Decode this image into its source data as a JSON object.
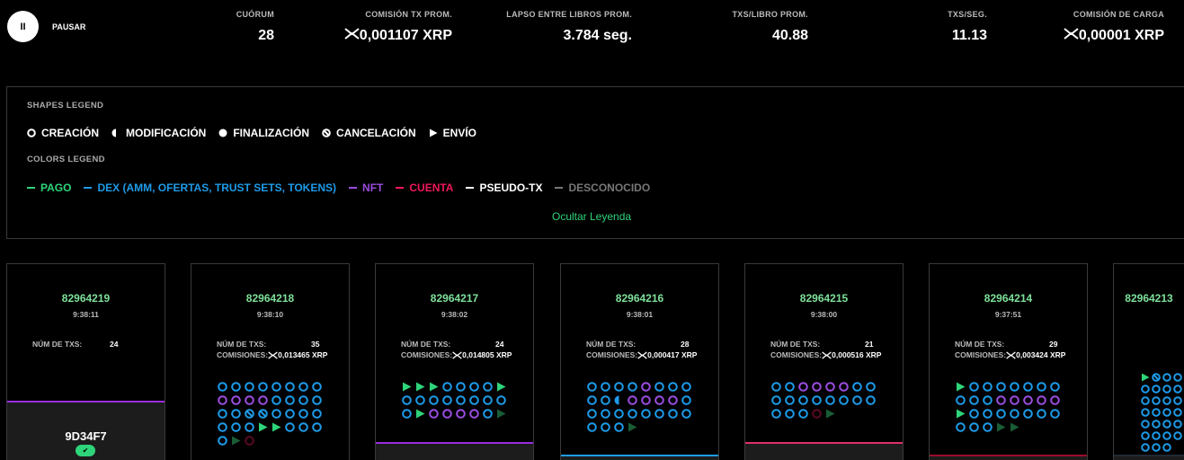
{
  "header": {
    "pause_label": "PAUSAR",
    "pause_icon": "II",
    "stats": [
      {
        "label": "CUÓRUM",
        "value": "28",
        "xrp": false
      },
      {
        "label": "COMISIÓN TX PROM.",
        "value": "0,001107 XRP",
        "xrp": true
      },
      {
        "label": "LAPSO ENTRE LIBROS PROM.",
        "value": "3.784 seg.",
        "xrp": false
      },
      {
        "label": "TXS/LIBRO PROM.",
        "value": "40.88",
        "xrp": false
      },
      {
        "label": "TXS/SEG.",
        "value": "11.13",
        "xrp": false
      },
      {
        "label": "COMISIÓN DE CARGA",
        "value": "0,00001 XRP",
        "xrp": true
      }
    ]
  },
  "legend": {
    "shapes_title": "SHAPES LEGEND",
    "shapes": [
      {
        "shape": "o",
        "label": "CREACIÓN"
      },
      {
        "shape": "h",
        "label": "MODIFICACIÓN"
      },
      {
        "shape": "f",
        "label": "FINALIZACIÓN"
      },
      {
        "shape": "x",
        "label": "CANCELACIÓN"
      },
      {
        "shape": "t",
        "label": "ENVÍO"
      }
    ],
    "colors_title": "COLORS LEGEND",
    "colors": [
      {
        "label": "PAGO",
        "color": "#2ed47a"
      },
      {
        "label": "DEX (AMM, OFERTAS, TRUST SETS, TOKENS)",
        "color": "#1e9be8"
      },
      {
        "label": "NFT",
        "color": "#9b4de0"
      },
      {
        "label": "CUENTA",
        "color": "#f0185a"
      },
      {
        "label": "PSEUDO-TX",
        "color": "#ffffff"
      },
      {
        "label": "DESCONOCIDO",
        "color": "#777777"
      }
    ],
    "hide_label": "Ocultar Leyenda"
  },
  "labels": {
    "txs": "NÚM DE TXS:",
    "fees": "COMISIONES:"
  },
  "ledgers": [
    {
      "index": "82964219",
      "time": "9:38:11",
      "txs": "24",
      "fees": null,
      "hash": "9D34F7",
      "validated": true,
      "bar": "#9b2be0",
      "barTop": 152,
      "txlist": []
    },
    {
      "index": "82964218",
      "time": "9:38:10",
      "txs": "35",
      "fees": "0,013465 XRP",
      "bar": "#9b2be0",
      "barTop": 260,
      "txlist": [
        "oD",
        "oD",
        "oD",
        "oD",
        "oD",
        "oD",
        "oD",
        "oD",
        "oN",
        "oN",
        "oN",
        "oN",
        "oD",
        "oD",
        "oD",
        "oD",
        "oD",
        "oD",
        "xD",
        "xD",
        "oD",
        "oD",
        "oD",
        "oD",
        "oD",
        "oD",
        "oD",
        "tP",
        "tP",
        "oD",
        "oD",
        "oD",
        "oD",
        "tp",
        "oa"
      ]
    },
    {
      "index": "82964217",
      "time": "9:38:02",
      "txs": "24",
      "fees": "0,014805 XRP",
      "bar": "#9b2be0",
      "barTop": 198,
      "txlist": [
        "tP",
        "tP",
        "tP",
        "oD",
        "oD",
        "oD",
        "oD",
        "tP",
        "oD",
        "oD",
        "oD",
        "oD",
        "oD",
        "oD",
        "oD",
        "oD",
        "oD",
        "tP",
        "oN",
        "oN",
        "oN",
        "oN",
        "oD",
        "tp"
      ]
    },
    {
      "index": "82964216",
      "time": "9:38:01",
      "txs": "28",
      "fees": "0,000417 XRP",
      "bar": "#1e9be8",
      "barTop": 212,
      "txlist": [
        "oD",
        "oD",
        "oD",
        "oD",
        "oN",
        "oD",
        "oD",
        "oD",
        "oD",
        "oD",
        "hD",
        "oN",
        "oN",
        "oN",
        "oN",
        "oD",
        "oD",
        "oD",
        "oD",
        "oD",
        "oD",
        "oD",
        "oD",
        "oD",
        "oD",
        "oD",
        "oD",
        "tp"
      ]
    },
    {
      "index": "82964215",
      "time": "9:38:00",
      "txs": "21",
      "fees": "0,000516 XRP",
      "bar": "#e0306a",
      "barTop": 198,
      "txlist": [
        "oD",
        "oD",
        "oN",
        "oN",
        "oN",
        "oN",
        "oD",
        "oD",
        "oD",
        "oD",
        "oD",
        "oD",
        "oD",
        "oD",
        "oD",
        "oD",
        "oD",
        "oD",
        "oD",
        "oa",
        "tp"
      ]
    },
    {
      "index": "82964214",
      "time": "9:37:51",
      "txs": "29",
      "fees": "0,003424 XRP",
      "bar": "#9a0c2a",
      "barTop": 212,
      "txlist": [
        "tP",
        "oD",
        "oD",
        "oD",
        "oD",
        "oD",
        "oD",
        "oD",
        "oD",
        "oD",
        "oD",
        "oN",
        "oN",
        "oN",
        "oN",
        "oN",
        "tP",
        "oD",
        "oD",
        "oD",
        "oD",
        "oD",
        "oD",
        "oD",
        "oD",
        "oD",
        "oD",
        "tp",
        "tp"
      ]
    },
    {
      "index": "82964213",
      "time": "",
      "txs": "",
      "fees": "",
      "bar": "#222a33",
      "barTop": 212,
      "txlist": [
        "tP",
        "xD",
        "oD",
        "oD",
        "oD",
        "oD",
        "oD",
        "oD",
        "oD",
        "oD",
        "oD",
        "oD",
        "oD",
        "oD",
        "oD",
        "oD",
        "oD",
        "oD",
        "oD",
        "oD",
        "oD",
        "oD",
        "oD",
        "oD",
        "oD",
        "oD",
        "oD"
      ]
    }
  ]
}
